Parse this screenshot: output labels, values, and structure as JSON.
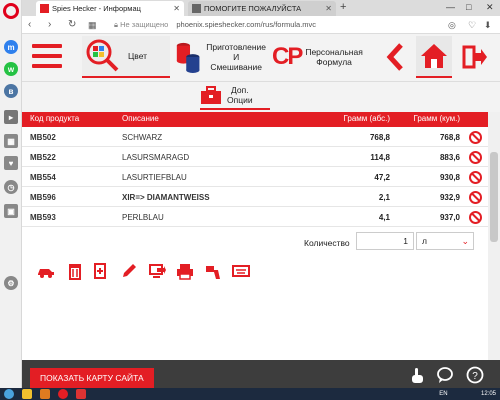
{
  "browser": {
    "tabs": [
      {
        "label": "Spies Hecker - Информац",
        "active": true
      },
      {
        "label": "ПОМОГИТЕ ПОЖАЛУЙСТА",
        "active": false
      }
    ],
    "window_controls": {
      "minimize": "—",
      "maximize": "□",
      "close": "✕"
    },
    "address": {
      "secure_label": "Не защищено",
      "url": "phoenix.spieshecker.com/rus/formula.mvc"
    }
  },
  "header": {
    "color_label": "Цвет",
    "mix_label_1": "Приготовление",
    "mix_label_2": "И",
    "mix_label_3": "Смешивание",
    "cp_logo": "CP",
    "personal_label_1": "Персональная",
    "personal_label_2": "Формула",
    "extra_label_1": "Доп.",
    "extra_label_2": "Опции"
  },
  "table": {
    "headers": {
      "code": "Код продукта",
      "name": "Описание",
      "abs": "Грамм (абс.)",
      "cum": "Грамм (кум.)"
    },
    "rows": [
      {
        "code": "MB502",
        "name": "SCHWARZ",
        "abs": "768,8",
        "cum": "768,8"
      },
      {
        "code": "MB522",
        "name": "LASURSMARAGD",
        "abs": "114,8",
        "cum": "883,6"
      },
      {
        "code": "MB554",
        "name": "LASURTIEFBLAU",
        "abs": "47,2",
        "cum": "930,8"
      },
      {
        "code": "MB596",
        "name": "XIR=> DIAMANTWEISS",
        "abs": "2,1",
        "cum": "932,9"
      },
      {
        "code": "MB593",
        "name": "PERLBLAU",
        "abs": "4,1",
        "cum": "937,0"
      }
    ]
  },
  "quantity": {
    "label": "Количество",
    "value": "1",
    "unit": "л"
  },
  "bottom": {
    "map_button": "ПОКАЗАТЬ КАРТУ САЙТА"
  },
  "taskbar": {
    "lang": "EN",
    "time": "12:05"
  },
  "colors": {
    "brand_red": "#e31e24",
    "bottom_bar": "#3d3d3d"
  }
}
